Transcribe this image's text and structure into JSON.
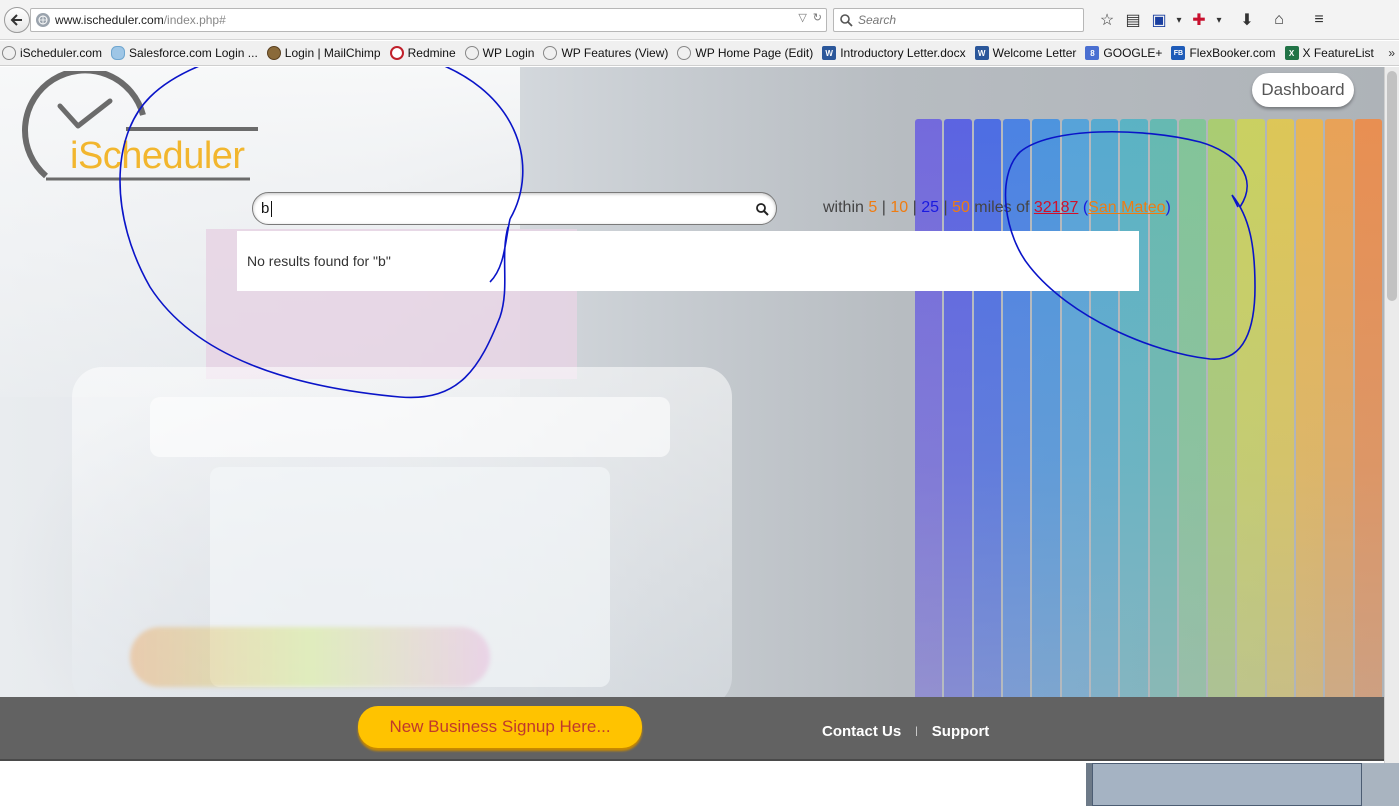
{
  "browser": {
    "url_host": "www.ischeduler.com",
    "url_path": "/index.php#",
    "search_placeholder": "Search"
  },
  "bookmarks": [
    {
      "label": "iScheduler.com",
      "icon": "clock-icon"
    },
    {
      "label": "Salesforce.com Login ...",
      "icon": "cloud-icon"
    },
    {
      "label": "Login | MailChimp",
      "icon": "mailchimp-icon"
    },
    {
      "label": "Redmine",
      "icon": "redmine-icon"
    },
    {
      "label": "WP Login",
      "icon": "clock-icon"
    },
    {
      "label": "WP Features (View)",
      "icon": "clock-icon"
    },
    {
      "label": "WP Home Page (Edit)",
      "icon": "clock-icon"
    },
    {
      "label": "Introductory Letter.docx",
      "icon": "word-icon",
      "glyph": "W"
    },
    {
      "label": "Welcome Letter",
      "icon": "word-icon",
      "glyph": "W"
    },
    {
      "label": "GOOGLE+",
      "icon": "google-icon",
      "glyph": "8"
    },
    {
      "label": "FlexBooker.com",
      "icon": "flexbooker-icon",
      "glyph": "FB"
    },
    {
      "label": "X FeatureList",
      "icon": "excel-icon",
      "glyph": "X"
    }
  ],
  "bookmarks_more": "»",
  "site": {
    "logo_text": "iScheduler",
    "dashboard_label": "Dashboard",
    "search_value": "b",
    "within": {
      "prefix": "within",
      "options": [
        "5",
        "10",
        "25",
        "50"
      ],
      "sep": "|",
      "suffix": "miles of",
      "zip": "32187",
      "paren_open": "(",
      "city": "San Mateo",
      "paren_close": ")"
    },
    "no_results": "No results found for \"b\""
  },
  "footer": {
    "signup_label": "New Business Signup Here...",
    "contact_label": "Contact Us",
    "separator": "|",
    "support_label": "Support"
  },
  "colors": {
    "logo_orange": "#f2b62e",
    "link_orange": "#ef7c12",
    "link_blue": "#1a1ae0",
    "zip_red": "#d0102a",
    "signup_yellow": "#ffc300",
    "signup_text": "#c0392b",
    "footer_gray": "#626262",
    "annotation_blue": "#0a14c8"
  }
}
